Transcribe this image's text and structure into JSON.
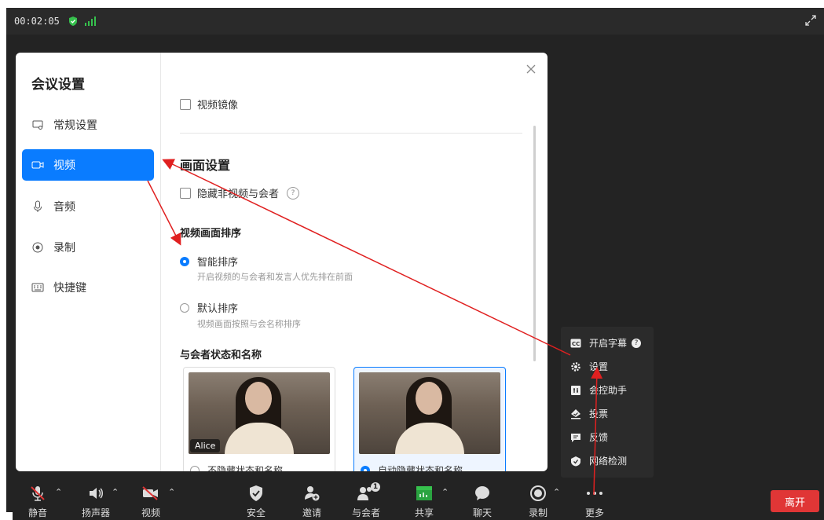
{
  "topbar": {
    "timer": "00:02:05"
  },
  "dialog": {
    "title": "会议设置",
    "nav": [
      {
        "label": "常规设置",
        "icon": "monitor-icon"
      },
      {
        "label": "视频",
        "icon": "video-camera-icon"
      },
      {
        "label": "音频",
        "icon": "microphone-icon"
      },
      {
        "label": "录制",
        "icon": "record-icon"
      },
      {
        "label": "快捷键",
        "icon": "keyboard-icon"
      }
    ],
    "mirror_label": "视频镜像",
    "section_title": "画面设置",
    "hide_non_video_label": "隐藏非视频与会者",
    "sort_title": "视频画面排序",
    "sort_options": [
      {
        "label": "智能排序",
        "desc": "开启视频的与会者和发言人优先排在前面",
        "selected": true
      },
      {
        "label": "默认排序",
        "desc": "视频画面按照与会名称排序",
        "selected": false
      }
    ],
    "status_title": "与会者状态和名称",
    "cards": [
      {
        "name": "Alice",
        "option": "不隐藏状态和名称",
        "selected": false
      },
      {
        "name": "",
        "option": "自动隐藏状态和名称",
        "selected": true
      }
    ]
  },
  "more_menu": {
    "items": [
      {
        "label": "开启字幕",
        "icon": "cc-icon",
        "help": "?"
      },
      {
        "label": "设置",
        "icon": "gear-icon"
      },
      {
        "label": "会控助手",
        "icon": "control-assistant-icon"
      },
      {
        "label": "投票",
        "icon": "vote-icon"
      },
      {
        "label": "反馈",
        "icon": "feedback-icon"
      },
      {
        "label": "网络检测",
        "icon": "network-check-icon"
      }
    ]
  },
  "toolbar": {
    "items": [
      {
        "label": "静音",
        "icon": "mic-muted-icon"
      },
      {
        "label": "扬声器",
        "icon": "speaker-icon"
      },
      {
        "label": "视频",
        "icon": "video-off-icon"
      },
      {
        "label": "安全",
        "icon": "shield-icon"
      },
      {
        "label": "邀请",
        "icon": "invite-icon"
      },
      {
        "label": "与会者",
        "icon": "participants-icon",
        "badge": "1"
      },
      {
        "label": "共享",
        "icon": "share-icon"
      },
      {
        "label": "聊天",
        "icon": "chat-icon"
      },
      {
        "label": "录制",
        "icon": "record-icon"
      },
      {
        "label": "更多",
        "icon": "more-icon"
      }
    ],
    "leave_label": "离开"
  },
  "colors": {
    "accent": "#0a7cff",
    "leave": "#e03636",
    "annotation": "#e02020",
    "signal": "#36c14d"
  }
}
